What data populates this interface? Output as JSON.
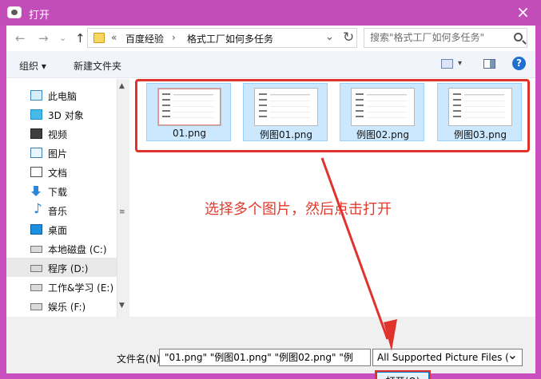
{
  "window": {
    "title": "打开",
    "close_label": "×"
  },
  "nav": {
    "back": "←",
    "forward": "→",
    "recent": "⌄",
    "up": "↑",
    "breadcrumb_prefix": "«",
    "breadcrumbs": [
      "百度经验",
      "格式工厂如何多任务"
    ],
    "separator": "›",
    "dropdown": "⌄",
    "refresh": "↻",
    "search_placeholder": "搜索\"格式工厂如何多任务\""
  },
  "toolbar": {
    "organize": "组织 ▾",
    "new_folder": "新建文件夹",
    "view_drop": "▾",
    "help": "?"
  },
  "sidebar": {
    "items": [
      {
        "label": "此电脑",
        "icon": "pc-icon",
        "selected": false
      },
      {
        "label": "3D 对象",
        "icon": "cube-icon",
        "selected": false
      },
      {
        "label": "视频",
        "icon": "video-icon",
        "selected": false
      },
      {
        "label": "图片",
        "icon": "pictures-icon",
        "selected": false
      },
      {
        "label": "文档",
        "icon": "documents-icon",
        "selected": false
      },
      {
        "label": "下载",
        "icon": "download-icon",
        "selected": false
      },
      {
        "label": "音乐",
        "icon": "music-icon",
        "selected": false
      },
      {
        "label": "桌面",
        "icon": "desktop-icon",
        "selected": false
      },
      {
        "label": "本地磁盘 (C:)",
        "icon": "drive-icon",
        "selected": false
      },
      {
        "label": "程序 (D:)",
        "icon": "drive-icon",
        "selected": true
      },
      {
        "label": "工作&学习 (E:)",
        "icon": "drive-icon",
        "selected": false
      },
      {
        "label": "娱乐 (F:)",
        "icon": "drive-icon",
        "selected": false
      }
    ],
    "scroll_up": "▲",
    "scroll_down": "▼",
    "scroll_grip": "≡"
  },
  "files": [
    {
      "name": "01.png"
    },
    {
      "name": "例图01.png"
    },
    {
      "name": "例图02.png"
    },
    {
      "name": "例图03.png"
    }
  ],
  "annotation": {
    "text": "选择多个图片，然后点击打开",
    "color": "#e23b2e"
  },
  "footer": {
    "filename_label": "文件名(N):",
    "filename_value": "\"01.png\" \"例图01.png\" \"例图02.png\" \"例",
    "filetype_value": "All Supported Picture Files (",
    "open_button": "打开(O)"
  },
  "colors": {
    "titlebar": "#c24db8",
    "selection_highlight": "#cce8ff",
    "annotation_red": "#e0332d"
  }
}
